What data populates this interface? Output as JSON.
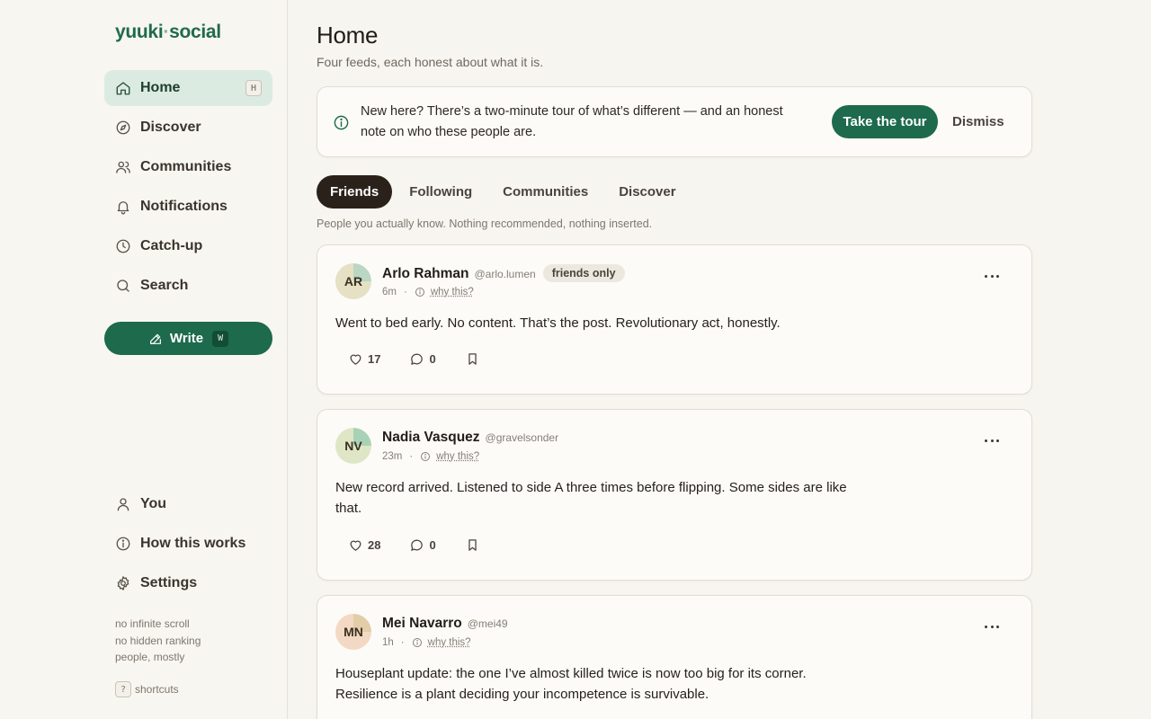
{
  "brand": {
    "name_part1": "yuuki",
    "dot": "·",
    "name_part2": "social",
    "color": "#1f6a4d"
  },
  "sidebar": {
    "nav": [
      {
        "label": "Home",
        "icon": "home-icon",
        "kbd": "H",
        "active": true
      },
      {
        "label": "Discover",
        "icon": "compass-icon"
      },
      {
        "label": "Communities",
        "icon": "users-icon"
      },
      {
        "label": "Notifications",
        "icon": "bell-icon"
      },
      {
        "label": "Catch-up",
        "icon": "clock-icon"
      },
      {
        "label": "Search",
        "icon": "search-icon"
      }
    ],
    "write": {
      "label": "Write",
      "kbd": "W"
    },
    "bottom_nav": [
      {
        "label": "You",
        "icon": "user-icon"
      },
      {
        "label": "How this works",
        "icon": "info-icon"
      },
      {
        "label": "Settings",
        "icon": "gear-icon"
      }
    ],
    "notes": [
      "no infinite scroll",
      "no hidden ranking",
      "people, mostly"
    ],
    "shortcuts": {
      "kbd": "?",
      "label": "shortcuts"
    }
  },
  "main": {
    "title": "Home",
    "subtitle": "Four feeds, each honest about what it is.",
    "banner": {
      "text": "New here? There’s a two-minute tour of what’s different — and an honest note on who these people are.",
      "cta": "Take the tour",
      "dismiss": "Dismiss"
    },
    "tabs": [
      "Friends",
      "Following",
      "Communities",
      "Discover"
    ],
    "active_tab": "Friends",
    "tab_description": "People you actually know. Nothing recommended, nothing inserted.",
    "posts": [
      {
        "initials": "AR",
        "name": "Arlo Rahman",
        "handle": "@arlo.lumen",
        "badge": "friends only",
        "time": "6m",
        "why": "why this?",
        "body": "Went to bed early. No content. That’s the post. Revolutionary act, honestly.",
        "likes": "17",
        "comments": "0",
        "avatar_bg": "#e6e0c4",
        "avatar_wedge": "#b9d7c3"
      },
      {
        "initials": "NV",
        "name": "Nadia Vasquez",
        "handle": "@gravelsonder",
        "badge": "",
        "time": "23m",
        "why": "why this?",
        "body": "New record arrived. Listened to side A three times before flipping. Some sides are like that.",
        "likes": "28",
        "comments": "0",
        "avatar_bg": "#dfe6c6",
        "avatar_wedge": "#a8d2b6"
      },
      {
        "initials": "MN",
        "name": "Mei Navarro",
        "handle": "@mei49",
        "badge": "",
        "time": "1h",
        "why": "why this?",
        "body": "Houseplant update: the one I’ve almost killed twice is now too big for its corner. Resilience is a plant deciding your incompetence is survivable.",
        "avatar_bg": "#f3d9c3",
        "avatar_wedge": "#e3cca8"
      }
    ]
  },
  "colors": {
    "accent": "#1d6a4c",
    "active_nav_bg": "#dcebe2",
    "tab_active_bg": "#2a211b",
    "background": "#f7f5f0"
  }
}
